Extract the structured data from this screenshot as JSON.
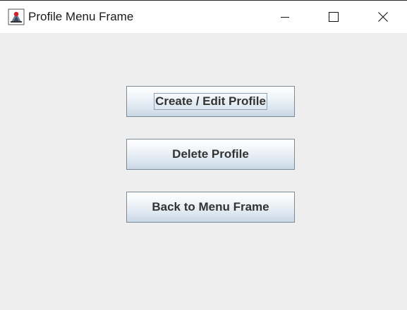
{
  "window": {
    "title": "Profile Menu Frame",
    "icon": "java-app-icon",
    "controls": {
      "minimize": "minimize-icon",
      "maximize": "maximize-icon",
      "close": "close-icon"
    }
  },
  "buttons": {
    "create_edit_label": "Create / Edit Profile",
    "delete_label": "Delete Profile",
    "back_label": "Back to Menu Frame"
  },
  "colors": {
    "background": "#eeeeee",
    "titlebar": "#ffffff",
    "button_border": "#7a8a99",
    "button_text": "#333333"
  }
}
